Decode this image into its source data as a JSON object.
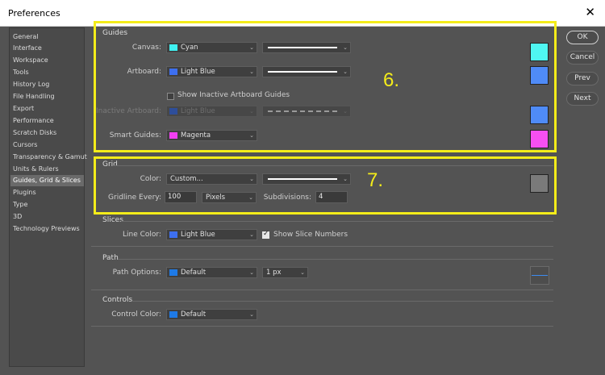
{
  "window": {
    "title": "Preferences",
    "close_icon": "close-icon"
  },
  "sidebar": {
    "items": [
      {
        "label": "General"
      },
      {
        "label": "Interface"
      },
      {
        "label": "Workspace"
      },
      {
        "label": "Tools"
      },
      {
        "label": "History Log"
      },
      {
        "label": "File Handling"
      },
      {
        "label": "Export"
      },
      {
        "label": "Performance"
      },
      {
        "label": "Scratch Disks"
      },
      {
        "label": "Cursors"
      },
      {
        "label": "Transparency & Gamut"
      },
      {
        "label": "Units & Rulers"
      },
      {
        "label": "Guides, Grid & Slices"
      },
      {
        "label": "Plugins"
      },
      {
        "label": "Type"
      },
      {
        "label": "3D"
      },
      {
        "label": "Technology Previews"
      }
    ],
    "selected": "Guides, Grid & Slices"
  },
  "buttons": {
    "ok": "OK",
    "cancel": "Cancel",
    "prev": "Prev",
    "next": "Next"
  },
  "guides": {
    "title": "Guides",
    "canvas": {
      "label": "Canvas:",
      "color_name": "Cyan",
      "color": "#3ff2f2",
      "style": "solid"
    },
    "artboard": {
      "label": "Artboard:",
      "color_name": "Light Blue",
      "color": "#3d6ff0",
      "style": "solid"
    },
    "show_inactive": {
      "label": "Show Inactive Artboard Guides",
      "checked": false
    },
    "inactive_artboard": {
      "label": "Inactive Artboard:",
      "color_name": "Light Blue",
      "color": "#2e4e9a",
      "style": "dashed"
    },
    "smart_guides": {
      "label": "Smart Guides:",
      "color_name": "Magenta",
      "color": "#f23ff2"
    },
    "swatches": {
      "canvas": "#4ff7f2",
      "artboard": "#4f8bf7",
      "inactive": "#4f8bf7",
      "smart": "#f74ff2"
    }
  },
  "grid": {
    "title": "Grid",
    "color": {
      "label": "Color:",
      "value": "Custom...",
      "swatch": "#7a7a7a"
    },
    "gridline_every": {
      "label": "Gridline Every:",
      "value": "100",
      "unit": "Pixels"
    },
    "subdivisions": {
      "label": "Subdivisions:",
      "value": "4"
    }
  },
  "slices": {
    "title": "Slices",
    "line_color": {
      "label": "Line Color:",
      "color_name": "Light Blue",
      "color": "#3d6ff0"
    },
    "show_numbers": {
      "label": "Show Slice Numbers",
      "checked": true
    }
  },
  "path": {
    "title": "Path",
    "options": {
      "label": "Path Options:",
      "color_name": "Default",
      "color": "#1e7ae6",
      "width": "1 px"
    }
  },
  "controls": {
    "title": "Controls",
    "color": {
      "label": "Control Color:",
      "color_name": "Default",
      "color": "#1e7ae6"
    }
  },
  "annotations": {
    "six": "6.",
    "seven": "7.",
    "highlight_color": "#f4ec1a"
  }
}
